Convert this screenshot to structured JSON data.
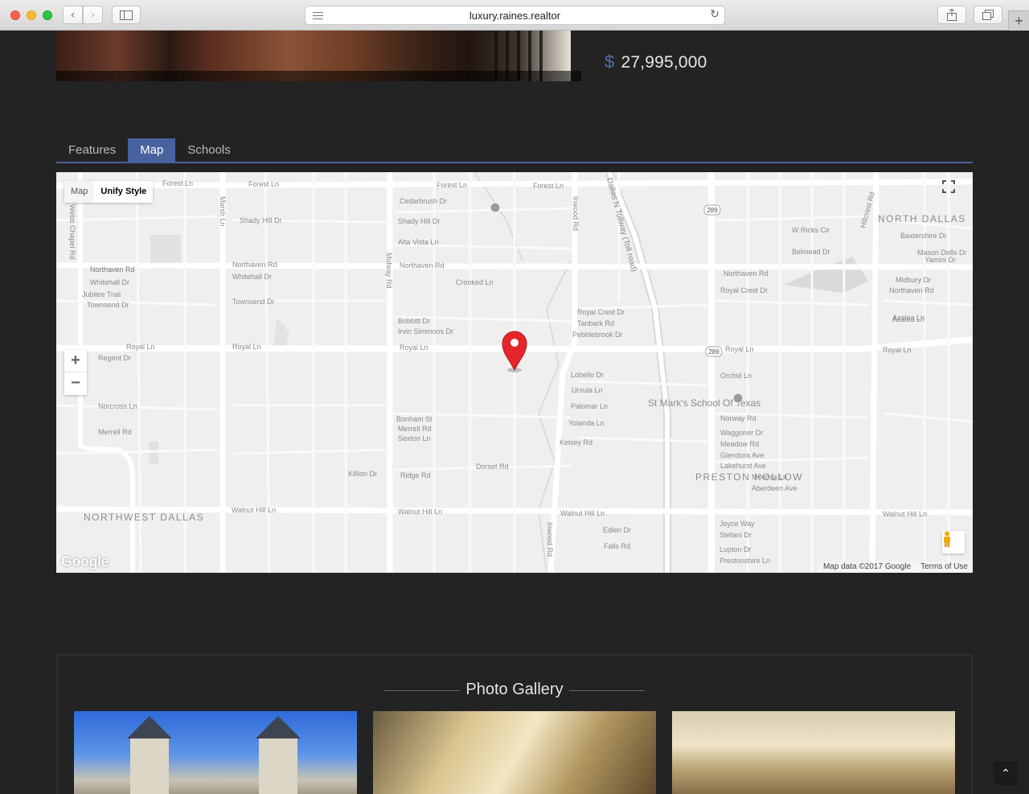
{
  "browser": {
    "url": "luxury.raines.realtor"
  },
  "listing": {
    "currency_symbol": "$",
    "price": "27,995,000"
  },
  "tabs": [
    {
      "label": "Features",
      "active": false
    },
    {
      "label": "Map",
      "active": true
    },
    {
      "label": "Schools",
      "active": false
    }
  ],
  "map": {
    "type_control": {
      "map_label": "Map",
      "style_label": "Unify Style"
    },
    "zoom_in": "+",
    "zoom_out": "−",
    "attribution": "Map data ©2017 Google",
    "terms": "Terms of Use",
    "logo": "Google",
    "streets": [
      {
        "label": "Forest Ln"
      },
      {
        "label": "Forest Ln"
      },
      {
        "label": "Forest Ln"
      },
      {
        "label": "Forest Ln"
      },
      {
        "label": "Northaven Rd"
      },
      {
        "label": "Northaven Rd"
      },
      {
        "label": "Northaven Rd"
      },
      {
        "label": "Royal Ln"
      },
      {
        "label": "Royal Ln"
      },
      {
        "label": "Royal Ln"
      },
      {
        "label": "Royal Ln"
      },
      {
        "label": "Royal Ln"
      },
      {
        "label": "Walnut Hill Ln"
      },
      {
        "label": "Walnut Hill Ln"
      },
      {
        "label": "Walnut Hill Ln"
      },
      {
        "label": "Walnut Hill Ln"
      },
      {
        "label": "Midway Rd"
      },
      {
        "label": "Inwood Rd"
      },
      {
        "label": "Inwood Rd"
      },
      {
        "label": "Hillcrest Rd"
      },
      {
        "label": "Marsh Ln"
      },
      {
        "label": "Webb Chapel Rd"
      },
      {
        "label": "Cedarbrush Dr"
      },
      {
        "label": "Shady Hill Dr"
      },
      {
        "label": "Alta Vista Ln"
      },
      {
        "label": "Crooked Ln"
      },
      {
        "label": "Bobbitt Dr"
      },
      {
        "label": "Irvin Simmons Dr"
      },
      {
        "label": "Bonham St"
      },
      {
        "label": "Merrell Rd"
      },
      {
        "label": "Sexton Ln"
      },
      {
        "label": "Killion Dr"
      },
      {
        "label": "Ridge Rd"
      },
      {
        "label": "Dorset Rd"
      },
      {
        "label": "Royal Crest Dr"
      },
      {
        "label": "Tanbark Rd"
      },
      {
        "label": "Pebblebrook Dr"
      },
      {
        "label": "Lobello Dr"
      },
      {
        "label": "Ursula Ln"
      },
      {
        "label": "Palomar Ln"
      },
      {
        "label": "Yolanda Ln"
      },
      {
        "label": "Kelsey Rd"
      },
      {
        "label": "Edlen Dr"
      },
      {
        "label": "Falls Rd"
      },
      {
        "label": "W Ricks Cir"
      },
      {
        "label": "Belmead Dr"
      },
      {
        "label": "Northaven Rd"
      },
      {
        "label": "Royal Crest Dr"
      },
      {
        "label": "Azalea Ln"
      },
      {
        "label": "Orchid Ln"
      },
      {
        "label": "Norway Rd"
      },
      {
        "label": "Waggoner Dr"
      },
      {
        "label": "Meadow Rd"
      },
      {
        "label": "Glendora Ave"
      },
      {
        "label": "Lakehurst Ave"
      },
      {
        "label": "Mimosa Ln"
      },
      {
        "label": "Aberdeen Ave"
      },
      {
        "label": "Joyce Way"
      },
      {
        "label": "Stefani Dr"
      },
      {
        "label": "Lupton Dr"
      },
      {
        "label": "Prestonshire Ln"
      },
      {
        "label": "Midbury Dr"
      },
      {
        "label": "Northaven Rd"
      },
      {
        "label": "Azalea Ln"
      },
      {
        "label": "Baxtershire Dr"
      },
      {
        "label": "Mason Dells Dr"
      },
      {
        "label": "Yamini Dr"
      },
      {
        "label": "Shady Hill Dr"
      },
      {
        "label": "Northaven Rd"
      },
      {
        "label": "Whitehall Dr"
      },
      {
        "label": "Jubilee Trail"
      },
      {
        "label": "Townsend Dr"
      },
      {
        "label": "Regent Dr"
      },
      {
        "label": "Norcross Ln"
      },
      {
        "label": "Merrell Rd"
      },
      {
        "label": "Townsend Dr"
      },
      {
        "label": "Whitehall Dr"
      },
      {
        "label": "Northaven Rd"
      }
    ],
    "areas": [
      {
        "label": "NORTH DALLAS"
      },
      {
        "label": "NORTHWEST DALLAS"
      },
      {
        "label": "PRESTON HOLLOW"
      },
      {
        "label": "St Mark's School Of Texas"
      }
    ],
    "highway": "Dallas N Tollway (Toll road)",
    "shield": "289"
  },
  "gallery": {
    "title": "Photo Gallery"
  },
  "icons": {
    "back": "chevron-left-icon",
    "forward": "chevron-right-icon",
    "sidebar": "sidebar-icon",
    "reload": "reload-icon",
    "share": "share-icon",
    "tabs": "tabs-overview-icon",
    "new_tab": "plus-icon",
    "pin": "map-pin-icon",
    "fullscreen": "fullscreen-icon",
    "pegman": "street-view-pegman-icon",
    "scroll_top": "chevron-up-icon"
  },
  "colors": {
    "accent": "#48629f",
    "background": "#232323",
    "pin": "#e5252a"
  }
}
